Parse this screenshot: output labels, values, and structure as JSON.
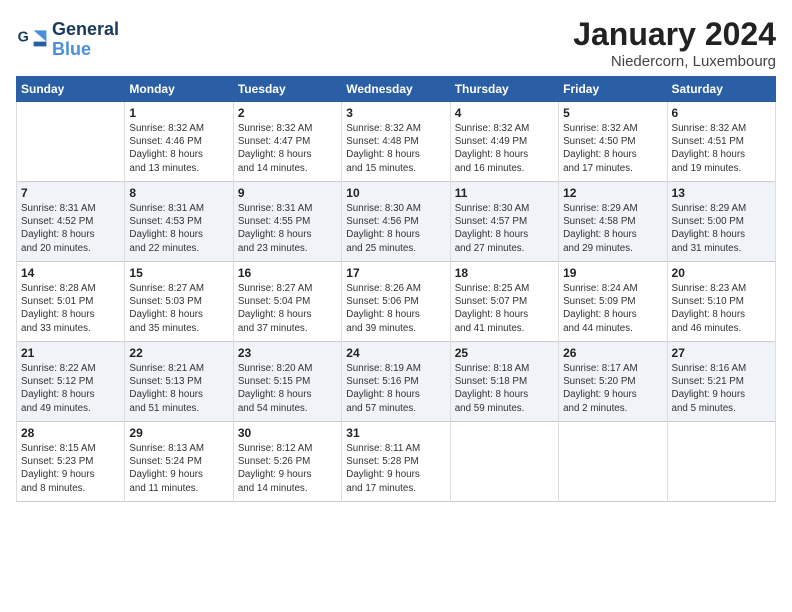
{
  "header": {
    "logo_line1": "General",
    "logo_line2": "Blue",
    "month_title": "January 2024",
    "subtitle": "Niedercorn, Luxembourg"
  },
  "weekdays": [
    "Sunday",
    "Monday",
    "Tuesday",
    "Wednesday",
    "Thursday",
    "Friday",
    "Saturday"
  ],
  "weeks": [
    [
      {
        "day": "",
        "content": ""
      },
      {
        "day": "1",
        "content": "Sunrise: 8:32 AM\nSunset: 4:46 PM\nDaylight: 8 hours\nand 13 minutes."
      },
      {
        "day": "2",
        "content": "Sunrise: 8:32 AM\nSunset: 4:47 PM\nDaylight: 8 hours\nand 14 minutes."
      },
      {
        "day": "3",
        "content": "Sunrise: 8:32 AM\nSunset: 4:48 PM\nDaylight: 8 hours\nand 15 minutes."
      },
      {
        "day": "4",
        "content": "Sunrise: 8:32 AM\nSunset: 4:49 PM\nDaylight: 8 hours\nand 16 minutes."
      },
      {
        "day": "5",
        "content": "Sunrise: 8:32 AM\nSunset: 4:50 PM\nDaylight: 8 hours\nand 17 minutes."
      },
      {
        "day": "6",
        "content": "Sunrise: 8:32 AM\nSunset: 4:51 PM\nDaylight: 8 hours\nand 19 minutes."
      }
    ],
    [
      {
        "day": "7",
        "content": "Sunrise: 8:31 AM\nSunset: 4:52 PM\nDaylight: 8 hours\nand 20 minutes."
      },
      {
        "day": "8",
        "content": "Sunrise: 8:31 AM\nSunset: 4:53 PM\nDaylight: 8 hours\nand 22 minutes."
      },
      {
        "day": "9",
        "content": "Sunrise: 8:31 AM\nSunset: 4:55 PM\nDaylight: 8 hours\nand 23 minutes."
      },
      {
        "day": "10",
        "content": "Sunrise: 8:30 AM\nSunset: 4:56 PM\nDaylight: 8 hours\nand 25 minutes."
      },
      {
        "day": "11",
        "content": "Sunrise: 8:30 AM\nSunset: 4:57 PM\nDaylight: 8 hours\nand 27 minutes."
      },
      {
        "day": "12",
        "content": "Sunrise: 8:29 AM\nSunset: 4:58 PM\nDaylight: 8 hours\nand 29 minutes."
      },
      {
        "day": "13",
        "content": "Sunrise: 8:29 AM\nSunset: 5:00 PM\nDaylight: 8 hours\nand 31 minutes."
      }
    ],
    [
      {
        "day": "14",
        "content": "Sunrise: 8:28 AM\nSunset: 5:01 PM\nDaylight: 8 hours\nand 33 minutes."
      },
      {
        "day": "15",
        "content": "Sunrise: 8:27 AM\nSunset: 5:03 PM\nDaylight: 8 hours\nand 35 minutes."
      },
      {
        "day": "16",
        "content": "Sunrise: 8:27 AM\nSunset: 5:04 PM\nDaylight: 8 hours\nand 37 minutes."
      },
      {
        "day": "17",
        "content": "Sunrise: 8:26 AM\nSunset: 5:06 PM\nDaylight: 8 hours\nand 39 minutes."
      },
      {
        "day": "18",
        "content": "Sunrise: 8:25 AM\nSunset: 5:07 PM\nDaylight: 8 hours\nand 41 minutes."
      },
      {
        "day": "19",
        "content": "Sunrise: 8:24 AM\nSunset: 5:09 PM\nDaylight: 8 hours\nand 44 minutes."
      },
      {
        "day": "20",
        "content": "Sunrise: 8:23 AM\nSunset: 5:10 PM\nDaylight: 8 hours\nand 46 minutes."
      }
    ],
    [
      {
        "day": "21",
        "content": "Sunrise: 8:22 AM\nSunset: 5:12 PM\nDaylight: 8 hours\nand 49 minutes."
      },
      {
        "day": "22",
        "content": "Sunrise: 8:21 AM\nSunset: 5:13 PM\nDaylight: 8 hours\nand 51 minutes."
      },
      {
        "day": "23",
        "content": "Sunrise: 8:20 AM\nSunset: 5:15 PM\nDaylight: 8 hours\nand 54 minutes."
      },
      {
        "day": "24",
        "content": "Sunrise: 8:19 AM\nSunset: 5:16 PM\nDaylight: 8 hours\nand 57 minutes."
      },
      {
        "day": "25",
        "content": "Sunrise: 8:18 AM\nSunset: 5:18 PM\nDaylight: 8 hours\nand 59 minutes."
      },
      {
        "day": "26",
        "content": "Sunrise: 8:17 AM\nSunset: 5:20 PM\nDaylight: 9 hours\nand 2 minutes."
      },
      {
        "day": "27",
        "content": "Sunrise: 8:16 AM\nSunset: 5:21 PM\nDaylight: 9 hours\nand 5 minutes."
      }
    ],
    [
      {
        "day": "28",
        "content": "Sunrise: 8:15 AM\nSunset: 5:23 PM\nDaylight: 9 hours\nand 8 minutes."
      },
      {
        "day": "29",
        "content": "Sunrise: 8:13 AM\nSunset: 5:24 PM\nDaylight: 9 hours\nand 11 minutes."
      },
      {
        "day": "30",
        "content": "Sunrise: 8:12 AM\nSunset: 5:26 PM\nDaylight: 9 hours\nand 14 minutes."
      },
      {
        "day": "31",
        "content": "Sunrise: 8:11 AM\nSunset: 5:28 PM\nDaylight: 9 hours\nand 17 minutes."
      },
      {
        "day": "",
        "content": ""
      },
      {
        "day": "",
        "content": ""
      },
      {
        "day": "",
        "content": ""
      }
    ]
  ]
}
